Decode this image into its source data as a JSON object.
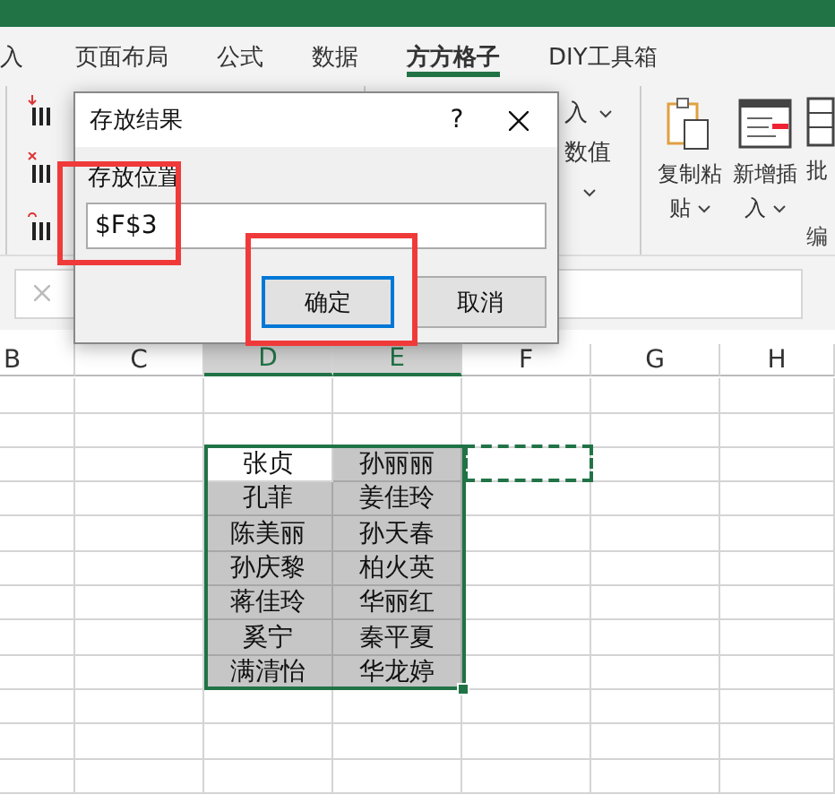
{
  "ribbon_tabs": [
    {
      "label": "入",
      "selected": false
    },
    {
      "label": "页面布局",
      "selected": false
    },
    {
      "label": "公式",
      "selected": false
    },
    {
      "label": "数据",
      "selected": false
    },
    {
      "label": "方方格子",
      "selected": true
    },
    {
      "label": "DIY工具箱",
      "selected": false
    }
  ],
  "ribbon": {
    "middle_items": [
      {
        "kind": "label",
        "label": "入",
        "dropdown": true
      },
      {
        "kind": "label",
        "label": "数值",
        "dropdown": false
      },
      {
        "kind": "caret"
      }
    ],
    "buttons": [
      {
        "kind": "clipboard",
        "lines": [
          "复制粘",
          "贴"
        ],
        "dropdown": true
      },
      {
        "kind": "insert",
        "lines": [
          "新增插",
          "入"
        ],
        "dropdown": true
      },
      {
        "kind": "batch",
        "lines": [
          "批"
        ],
        "dropdown": false
      }
    ],
    "group_label": "编"
  },
  "sheet": {
    "columns": [
      {
        "label": "B",
        "selected": false
      },
      {
        "label": "C",
        "selected": false
      },
      {
        "label": "D",
        "selected": true
      },
      {
        "label": "E",
        "selected": true
      },
      {
        "label": "F",
        "selected": false
      },
      {
        "label": "G",
        "selected": false
      },
      {
        "label": "H",
        "selected": false
      }
    ],
    "data_rows": [
      [
        {
          "text": "张贞",
          "shaded": false
        },
        {
          "text": "孙丽丽",
          "shaded": true
        }
      ],
      [
        {
          "text": "孔菲",
          "shaded": true
        },
        {
          "text": "姜佳玲",
          "shaded": true
        }
      ],
      [
        {
          "text": "陈美丽",
          "shaded": true
        },
        {
          "text": "孙天春",
          "shaded": true
        }
      ],
      [
        {
          "text": "孙庆黎",
          "shaded": true
        },
        {
          "text": "柏火英",
          "shaded": true
        }
      ],
      [
        {
          "text": "蒋佳玲",
          "shaded": true
        },
        {
          "text": "华丽红",
          "shaded": true
        }
      ],
      [
        {
          "text": "奚宁",
          "shaded": true
        },
        {
          "text": "秦平夏",
          "shaded": true
        }
      ],
      [
        {
          "text": "满清怡",
          "shaded": true
        },
        {
          "text": "华龙婷",
          "shaded": true
        }
      ]
    ]
  },
  "dialog": {
    "title": "存放结果",
    "help": "?",
    "field_label": "存放位置",
    "field_value": "$F$3",
    "buttons": [
      {
        "label": "确定",
        "default": true
      },
      {
        "label": "取消",
        "default": false
      }
    ]
  }
}
